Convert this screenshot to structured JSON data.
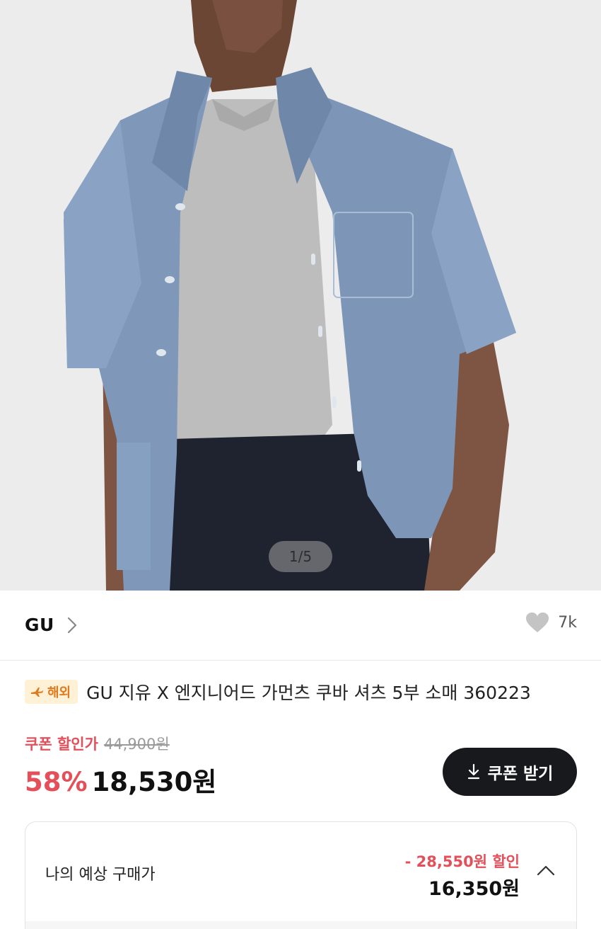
{
  "gallery": {
    "counter": "1/5"
  },
  "brand": {
    "name": "GU",
    "like_count": "7k"
  },
  "product": {
    "badge": "해외",
    "title": "GU 지유 X 엔지니어드 가먼츠 쿠바 셔츠 5부 소매 360223"
  },
  "pricing": {
    "coupon_label": "쿠폰 할인가",
    "original_price": "44,900원",
    "discount_rate": "58%",
    "sale_price": "18,530원",
    "coupon_button": "쿠폰 받기"
  },
  "estimate": {
    "label": "나의 예상 구매가",
    "discount_text": "- 28,550원 할인",
    "final_price": "16,350원"
  },
  "colors": {
    "accent_red": "#e4505a",
    "button_dark": "#17191d",
    "badge_bg": "#fff1d6",
    "badge_text": "#e07a1f"
  }
}
